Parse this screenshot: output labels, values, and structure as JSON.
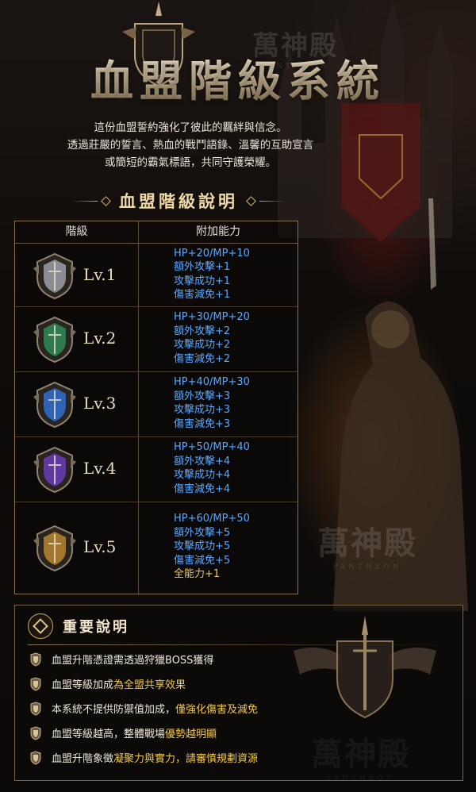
{
  "header": {
    "title": "血盟階級系統",
    "intro_lines": [
      "這份血盟誓約強化了彼此的羈絆與信念。",
      "透過莊嚴的誓言、熱血的戰鬥語錄、溫馨的互助宣言",
      "或簡短的霸氣標語，共同守護榮耀。"
    ]
  },
  "watermark": {
    "main": "萬神殿",
    "sub": "PANTHEON"
  },
  "levels_section": {
    "title": "血盟階級說明",
    "col_level": "階級",
    "col_ability": "附加能力",
    "rows": [
      {
        "level": "Lv.1",
        "badge_color": "#9aa0a6",
        "stats": [
          "HP+20/MP+10",
          "額外攻擊+1",
          "攻擊成功+1",
          "傷害減免+1"
        ]
      },
      {
        "level": "Lv.2",
        "badge_color": "#2e8a57",
        "stats": [
          "HP+30/MP+20",
          "額外攻擊+2",
          "攻擊成功+2",
          "傷害減免+2"
        ]
      },
      {
        "level": "Lv.3",
        "badge_color": "#2f6fd0",
        "stats": [
          "HP+40/MP+30",
          "額外攻擊+3",
          "攻擊成功+3",
          "傷害減免+3"
        ]
      },
      {
        "level": "Lv.4",
        "badge_color": "#6b3bb8",
        "stats": [
          "HP+50/MP+40",
          "額外攻擊+4",
          "攻擊成功+4",
          "傷害減免+4"
        ]
      },
      {
        "level": "Lv.5",
        "badge_color": "#b8862e",
        "stats": [
          "HP+60/MP+50",
          "額外攻擊+5",
          "攻擊成功+5",
          "傷害減免+5"
        ],
        "extra": "全能力+1"
      }
    ]
  },
  "notes": {
    "title": "重要說明",
    "items": [
      {
        "text": "血盟升階憑證需透過狩獵BOSS獲得",
        "highlight": ""
      },
      {
        "text": "血盟等級加成",
        "highlight": "為全盟共享效果"
      },
      {
        "text": "本系統不提供防禦值加成，",
        "highlight": "僅強化傷害及減免"
      },
      {
        "text": "血盟等級越高，整體戰場",
        "highlight": "優勢越明顯"
      },
      {
        "text": "血盟升階象徵",
        "highlight": "凝聚力與實力，請審慎規劃資源"
      }
    ]
  },
  "colors": {
    "stat_blue": "#5aa8ff",
    "highlight_gold": "#f2c94c",
    "border_gold": "#8a7250"
  }
}
